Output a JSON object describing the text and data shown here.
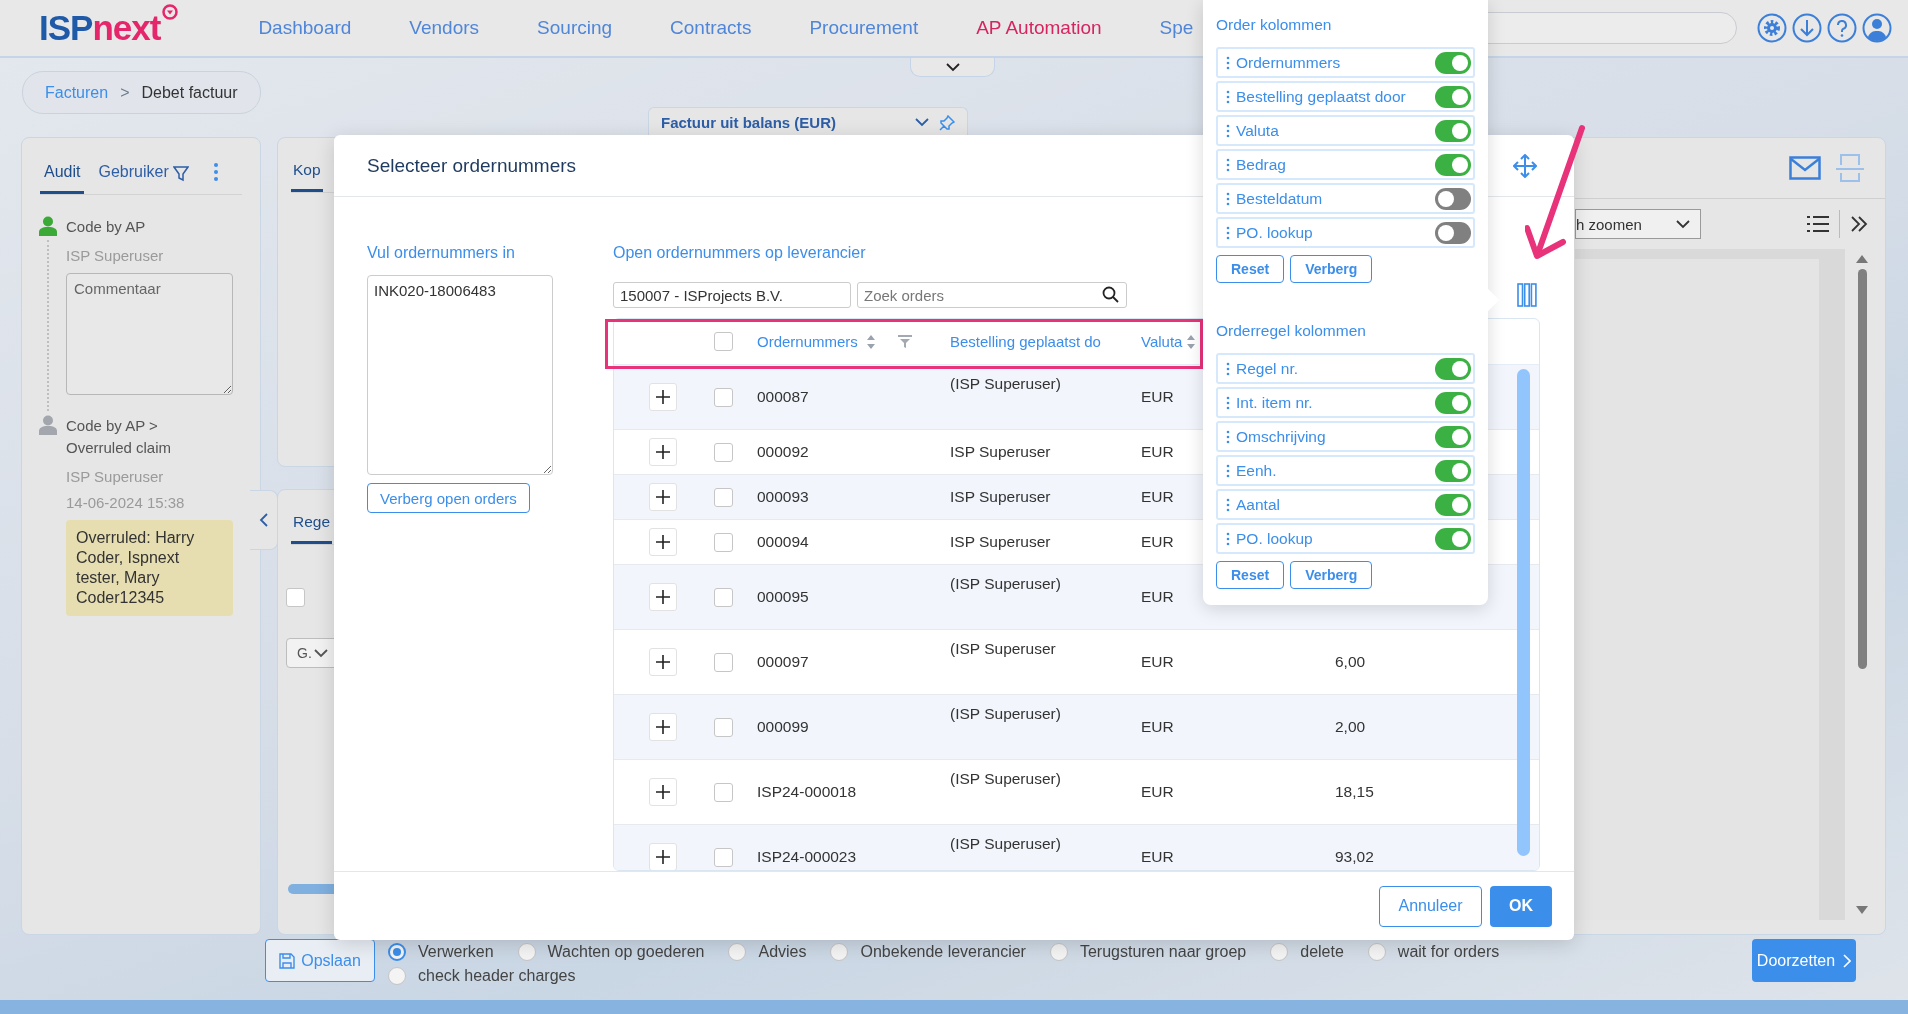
{
  "nav": {
    "logo": {
      "prefix": "ISP",
      "suffix": "next"
    },
    "items": [
      {
        "label": "Dashboard",
        "selected": false
      },
      {
        "label": "Vendors",
        "selected": false
      },
      {
        "label": "Sourcing",
        "selected": false
      },
      {
        "label": "Contracts",
        "selected": false
      },
      {
        "label": "Procurement",
        "selected": false
      },
      {
        "label": "AP Automation",
        "selected": true
      },
      {
        "label": "Spe",
        "selected": false
      }
    ]
  },
  "breadcrumb": {
    "items": [
      "Facturen",
      "Debet factuur"
    ],
    "separator": ">"
  },
  "balance_tab": {
    "title": "Factuur uit balans (EUR)"
  },
  "audit_panel": {
    "tabs": [
      {
        "label": "Audit",
        "selected": true
      },
      {
        "label": "Gebruiker",
        "selected": false
      }
    ],
    "entries": [
      {
        "title": "Code by AP",
        "color": "#3aa935",
        "user": "ISP Superuser",
        "comment_placeholder": "Commentaar"
      },
      {
        "title": "Code by AP > Overruled claim",
        "color": "#a3a7ad",
        "user": "ISP Superuser",
        "time": "14-06-2024 15:38",
        "note": "Overruled: Harry Coder, Ispnext tester, Mary Coder12345"
      }
    ]
  },
  "header_panel": {
    "tabs": [
      {
        "label": "Kop",
        "selected": true
      }
    ]
  },
  "lines_panel": {
    "tabs": [
      {
        "label": "Rege",
        "selected": true
      }
    ],
    "select_all_checked": false,
    "chip": "G."
  },
  "preview_panel": {
    "zoom_select": "h zoomen"
  },
  "modal": {
    "title": "Selecteer ordernummers",
    "manual": {
      "label": "Vul ordernummers in",
      "value": "INK020-18006483",
      "button": "Verberg open orders"
    },
    "open_orders": {
      "label": "Open ordernummers op leverancier",
      "vendor": "150007 - ISProjects B.V.",
      "search_placeholder": "Zoek orders",
      "select_all_checked": false,
      "columns": [
        {
          "label": "Ordernummers",
          "sortable": true,
          "filter": true
        },
        {
          "label": "Bestelling geplaatst do",
          "sortable": false,
          "filter": false
        },
        {
          "label": "Valuta",
          "sortable": true,
          "filter": false
        }
      ],
      "rows": [
        {
          "kind": "double",
          "checked": false,
          "order": "000087",
          "placed_by": "(ISP Superuser)",
          "currency": "EUR"
        },
        {
          "kind": "single",
          "checked": false,
          "order": "000092",
          "placed_by": "ISP Superuser",
          "currency": "EUR"
        },
        {
          "kind": "single",
          "checked": false,
          "order": "000093",
          "placed_by": "ISP Superuser",
          "currency": "EUR"
        },
        {
          "kind": "single",
          "checked": false,
          "order": "000094",
          "placed_by": "ISP Superuser",
          "currency": "EUR"
        },
        {
          "kind": "double",
          "checked": false,
          "order": "000095",
          "placed_by": "(ISP Superuser)",
          "currency": "EUR"
        },
        {
          "kind": "double",
          "checked": false,
          "order": "000097",
          "placed_by": "(ISP Superuser",
          "currency": "EUR",
          "amount": "6,00"
        },
        {
          "kind": "double",
          "checked": false,
          "order": "000099",
          "placed_by": "(ISP Superuser)",
          "currency": "EUR",
          "amount": "2,00"
        },
        {
          "kind": "double",
          "checked": false,
          "order": "ISP24-000018",
          "placed_by": "(ISP Superuser)",
          "currency": "EUR",
          "amount": "18,15"
        },
        {
          "kind": "double",
          "checked": false,
          "order": "ISP24-000023",
          "placed_by": "(ISP Superuser)",
          "currency": "EUR",
          "amount": "93,02"
        }
      ]
    },
    "buttons": {
      "cancel": "Annuleer",
      "ok": "OK"
    }
  },
  "column_panel": {
    "groups": [
      {
        "title": "Order kolommen",
        "items": [
          {
            "label": "Ordernummers",
            "on": true
          },
          {
            "label": "Bestelling geplaatst door",
            "on": true
          },
          {
            "label": "Valuta",
            "on": true
          },
          {
            "label": "Bedrag",
            "on": true
          },
          {
            "label": "Besteldatum",
            "on": false
          },
          {
            "label": "PO. lookup",
            "on": false
          }
        ],
        "buttons": [
          "Reset",
          "Verberg"
        ]
      },
      {
        "title": "Orderregel kolommen",
        "items": [
          {
            "label": "Regel nr.",
            "on": true
          },
          {
            "label": "Int. item nr.",
            "on": true
          },
          {
            "label": "Omschrijving",
            "on": true
          },
          {
            "label": "Eenh.",
            "on": true
          },
          {
            "label": "Aantal",
            "on": true
          },
          {
            "label": "PO. lookup",
            "on": true
          }
        ],
        "buttons": [
          "Reset",
          "Verberg"
        ]
      }
    ]
  },
  "footer": {
    "save": "Opslaan",
    "actions": [
      {
        "label": "Verwerken",
        "selected": true
      },
      {
        "label": "Wachten op goederen",
        "selected": false
      },
      {
        "label": "Advies",
        "selected": false
      },
      {
        "label": "Onbekende leverancier",
        "selected": false
      },
      {
        "label": "Terugsturen naar groep",
        "selected": false
      },
      {
        "label": "delete",
        "selected": false
      },
      {
        "label": "wait for orders",
        "selected": false
      },
      {
        "label": "check header charges",
        "selected": false
      }
    ],
    "submit": "Doorzetten"
  }
}
